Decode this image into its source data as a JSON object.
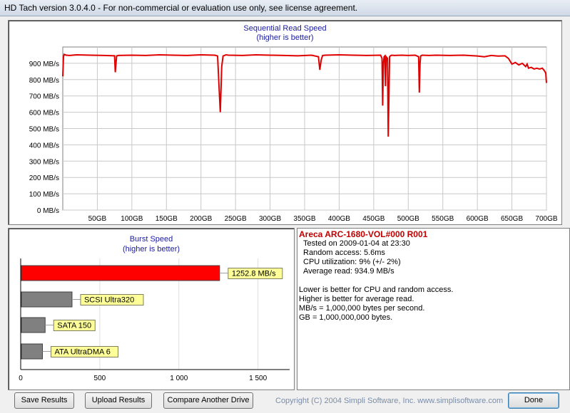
{
  "window": {
    "title": "HD Tach version 3.0.4.0  - For non-commercial or evaluation use only, see license agreement."
  },
  "colors": {
    "read_line": "#e00000",
    "burst_bar": "#ff0000",
    "ref_bar": "#808080",
    "label_bg": "#ffff99",
    "title_blue": "#1a1aa0",
    "drive_title": "#c00000"
  },
  "read_chart": {
    "title": "Sequential Read Speed",
    "subtitle": "(higher is better)"
  },
  "burst_chart": {
    "title": "Burst Speed",
    "subtitle": "(higher is better)"
  },
  "chart_data": [
    {
      "type": "line",
      "title": "Sequential Read Speed",
      "subtitle": "(higher is better)",
      "y_unit": "MB/s",
      "x_unit": "GB",
      "ylim": [
        0,
        1000
      ],
      "xlim": [
        0,
        700
      ],
      "y_ticks": [
        "0 MB/s",
        "100 MB/s",
        "200 MB/s",
        "300 MB/s",
        "400 MB/s",
        "500 MB/s",
        "600 MB/s",
        "700 MB/s",
        "800 MB/s",
        "900 MB/s"
      ],
      "y_tick_values": [
        0,
        100,
        200,
        300,
        400,
        500,
        600,
        700,
        800,
        900
      ],
      "x_ticks": [
        "50GB",
        "100GB",
        "150GB",
        "200GB",
        "250GB",
        "300GB",
        "350GB",
        "400GB",
        "450GB",
        "500GB",
        "550GB",
        "600GB",
        "650GB",
        "700GB"
      ],
      "x_tick_values": [
        50,
        100,
        150,
        200,
        250,
        300,
        350,
        400,
        450,
        500,
        550,
        600,
        650,
        700
      ],
      "grid": true,
      "series": [
        {
          "x": [
            0,
            1,
            2,
            5,
            10,
            20,
            40,
            60,
            75,
            76,
            77,
            78,
            80,
            100,
            120,
            140,
            160,
            180,
            200,
            220,
            224,
            226,
            228,
            230,
            232,
            234,
            236,
            240,
            260,
            280,
            300,
            320,
            340,
            360,
            370,
            372,
            374,
            376,
            380,
            400,
            420,
            440,
            460,
            462,
            463,
            464,
            465,
            466,
            467,
            468,
            470,
            471,
            472,
            473,
            474,
            476,
            480,
            490,
            500,
            510,
            515,
            516,
            517,
            518,
            520,
            530,
            540,
            560,
            580,
            600,
            610,
            620,
            630,
            640,
            645,
            650,
            655,
            660,
            665,
            670,
            672,
            674,
            678,
            682,
            686,
            690,
            694,
            697,
            699,
            700
          ],
          "y": [
            820,
            940,
            955,
            950,
            948,
            952,
            950,
            948,
            946,
            845,
            900,
            945,
            948,
            950,
            948,
            952,
            950,
            948,
            952,
            950,
            945,
            770,
            600,
            880,
            945,
            948,
            952,
            950,
            948,
            952,
            950,
            948,
            946,
            950,
            940,
            860,
            920,
            948,
            950,
            952,
            950,
            948,
            950,
            930,
            640,
            900,
            940,
            945,
            760,
            940,
            930,
            450,
            700,
            940,
            945,
            950,
            948,
            950,
            948,
            950,
            940,
            720,
            900,
            945,
            950,
            948,
            950,
            948,
            950,
            945,
            940,
            948,
            944,
            946,
            930,
            895,
            905,
            890,
            900,
            880,
            895,
            870,
            875,
            865,
            870,
            865,
            870,
            855,
            840,
            780
          ]
        }
      ]
    },
    {
      "type": "bar",
      "orientation": "horizontal",
      "title": "Burst Speed",
      "subtitle": "(higher is better)",
      "xlim": [
        0,
        1700
      ],
      "x_ticks": [
        "0",
        "500",
        "1 000",
        "1 500"
      ],
      "x_tick_values": [
        0,
        500,
        1000,
        1500
      ],
      "categories": [
        "",
        "SCSI Ultra320",
        "SATA 150",
        "ATA UltraDMA 6"
      ],
      "values": [
        1252.8,
        320,
        150,
        133
      ],
      "value_labels": [
        "1252.8 MB/s",
        "SCSI Ultra320",
        "SATA 150",
        "ATA UltraDMA 6"
      ],
      "bar_colors": [
        "#ff0000",
        "#808080",
        "#808080",
        "#808080"
      ]
    }
  ],
  "info": {
    "drive_name": "Areca ARC-1680-VOL#000 R001",
    "lines": [
      "Tested on 2009-01-04 at 23:30",
      "Random access: 5.6ms",
      "CPU utilization: 9% (+/- 2%)",
      "Average read: 934.9 MB/s"
    ],
    "notes": [
      "Lower is better for CPU and random access.",
      "Higher is better for average read.",
      "MB/s = 1,000,000 bytes per second.",
      "GB = 1,000,000,000 bytes."
    ]
  },
  "buttons": {
    "save": "Save Results",
    "upload": "Upload Results",
    "compare": "Compare Another Drive",
    "done": "Done"
  },
  "footer": {
    "copyright": "Copyright (C) 2004 Simpli Software, Inc. www.simplisoftware.com"
  }
}
